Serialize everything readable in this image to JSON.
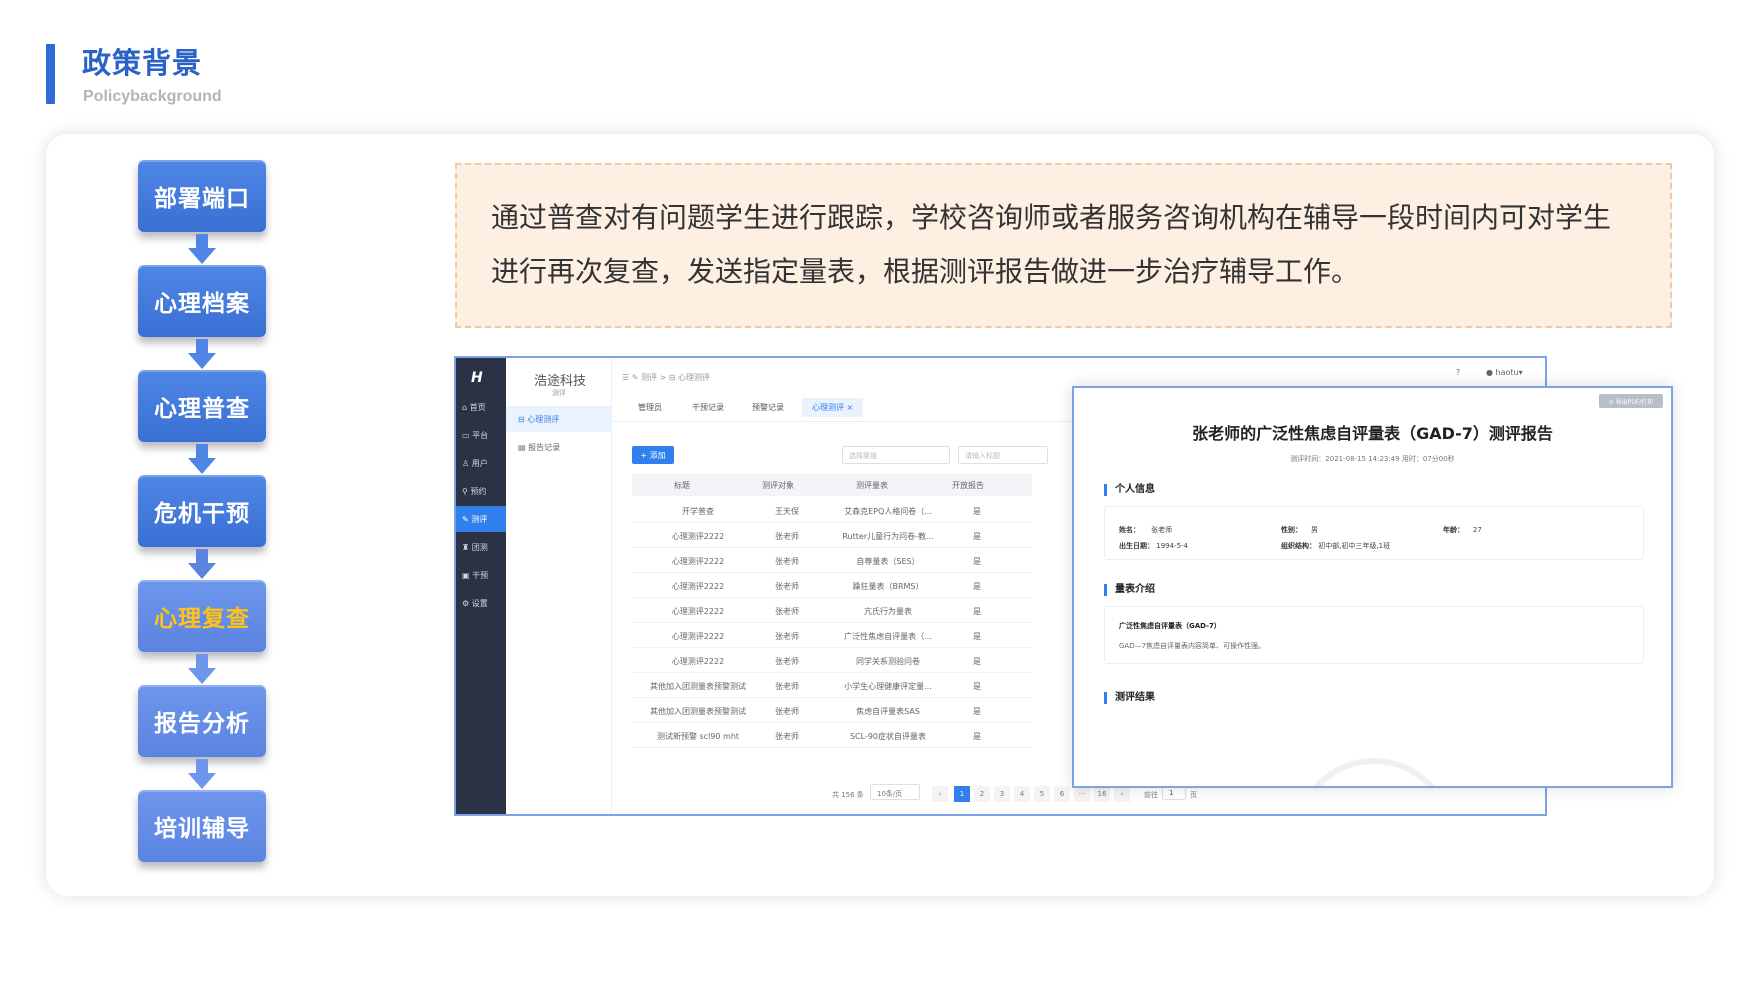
{
  "header": {
    "title": "政策背景",
    "subtitle": "Policybackground"
  },
  "colors": {
    "accent": "#2f6bd8",
    "active_step": "#ffc21a",
    "desc_bg": "#fdf0e3"
  },
  "flow": {
    "steps": [
      "部署端口",
      "心理档案",
      "心理普查",
      "危机干预",
      "心理复查",
      "报告分析",
      "培训辅导"
    ],
    "active_index": 4
  },
  "description": "通过普查对有问题学生进行跟踪，学校咨询师或者服务咨询机构在辅导一段时间内可对学生进行再次复查，发送指定量表，根据测评报告做进一步治疗辅导工作。",
  "app": {
    "brand": "浩途科技",
    "brand_sub": "测评",
    "nav": [
      "首页",
      "平台",
      "用户",
      "预约",
      "测评",
      "团测",
      "干预",
      "设置"
    ],
    "nav_active": 4,
    "subnav": [
      "心理测评",
      "报告记录"
    ],
    "breadcrumb": "☰   ✎ 测评  >  ⊟ 心理测评",
    "tabs": [
      "管理员",
      "干预记录",
      "预警记录",
      "心理测评 ×"
    ],
    "add_button": "+ 添加",
    "select_placeholder": "选择渠道",
    "search_placeholder": "请输入标题",
    "user": "haotu",
    "help_icon": "?",
    "columns": [
      "标题",
      "测评对象",
      "测评量表",
      "开放报告"
    ],
    "rows": [
      [
        "开学普查",
        "王天保",
        "艾森克EPQ人格问卷（...",
        "是"
      ],
      [
        "心理测评2222",
        "张老师",
        "Rutter儿童行为问卷-教...",
        "是"
      ],
      [
        "心理测评2222",
        "张老师",
        "自尊量表（SES）",
        "是"
      ],
      [
        "心理测评2222",
        "张老师",
        "躁狂量表（BRMS）",
        "是"
      ],
      [
        "心理测评2222",
        "张老师",
        "亢氏行为量表",
        "是"
      ],
      [
        "心理测评2222",
        "张老师",
        "广泛性焦虑自评量表（...",
        "是"
      ],
      [
        "心理测评2222",
        "张老师",
        "同学关系测验问卷",
        "是"
      ],
      [
        "其他加入团测量表预警测试",
        "张老师",
        "小学生心理健康评定量...",
        "是"
      ],
      [
        "其他加入团测量表预警测试",
        "张老师",
        "焦虑自评量表SAS",
        "是"
      ],
      [
        "测试新预警 scl90 mht",
        "张老师",
        "SCL-90症状自评量表",
        "是"
      ]
    ],
    "pager": {
      "total": "共 156 条",
      "page_size": "10条/页",
      "prev": "‹",
      "pages": [
        "1",
        "2",
        "3",
        "4",
        "5",
        "6",
        "···",
        "16"
      ],
      "next": "›",
      "goto_label": "前往",
      "goto_value": "1",
      "goto_unit": "页"
    }
  },
  "report": {
    "export_button": "⊙ 导出PDF/打印",
    "title": "张老师的广泛性焦虑自评量表（GAD-7）测评报告",
    "time": "测评时间：2021-08-15 14:23:49    用时：07分00秒",
    "section_personal": "个人信息",
    "fields": {
      "name_label": "姓名：",
      "name": "张老师",
      "gender_label": "性别：",
      "gender": "男",
      "age_label": "年龄：",
      "age": "27",
      "birth_label": "出生日期：",
      "birth": "1994-5-4",
      "org_label": "组织结构：",
      "org": "初中部,初中三年级,1班"
    },
    "section_scale": "量表介绍",
    "scale_name": "广泛性焦虑自评量表（GAD-7）",
    "scale_desc": "GAD—7焦虑自评量表内容简单、可操作性强。",
    "section_result": "测评结果"
  }
}
